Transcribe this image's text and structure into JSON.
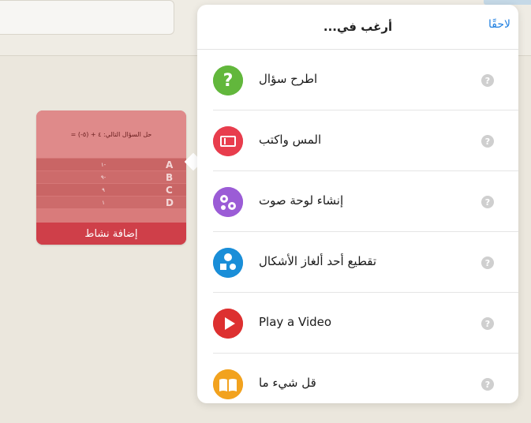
{
  "background": {
    "accent": "#ebe7dd"
  },
  "activity_card": {
    "question": "حل السؤال التالي: ٤ + (٥-) =",
    "rows": [
      {
        "letter": "A",
        "value": "١-"
      },
      {
        "letter": "B",
        "value": "٩-"
      },
      {
        "letter": "C",
        "value": "٩"
      },
      {
        "letter": "D",
        "value": "١"
      }
    ],
    "action_label": "إضافة نشاط",
    "color": "#cf3f49"
  },
  "popover": {
    "title": "أرغب في...",
    "later_label": "لاحقًا",
    "later_color": "#1f7fe0",
    "help_glyph": "?",
    "items": [
      {
        "label": "اطرح سؤال",
        "icon": "question-icon",
        "color": "#62b73c"
      },
      {
        "label": "المس واكتب",
        "icon": "touch-write-icon",
        "color": "#e83d4d"
      },
      {
        "label": "إنشاء لوحة صوت",
        "icon": "sound-board-icon",
        "color": "#9b5cd6"
      },
      {
        "label": "تقطيع أحد ألغاز الأشكال",
        "icon": "shapes-icon",
        "color": "#1a8ed8"
      },
      {
        "label": "Play a Video",
        "icon": "play-icon",
        "color": "#dd3030"
      },
      {
        "label": "قل شيء ما",
        "icon": "book-icon",
        "color": "#f2a21e"
      }
    ]
  }
}
